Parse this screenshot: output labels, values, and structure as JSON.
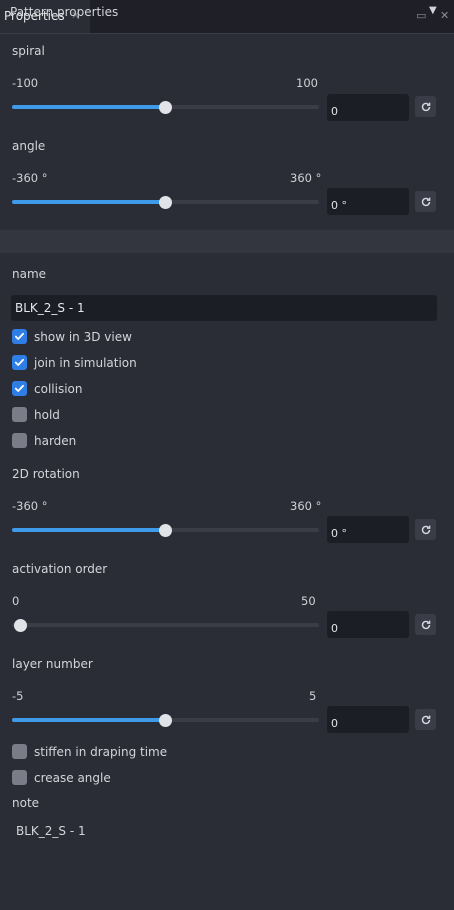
{
  "tab": {
    "label": "Properties"
  },
  "spiral": {
    "label": "spiral",
    "min": "-100",
    "max": "100",
    "value": "0",
    "level": 0.5
  },
  "angle": {
    "label": "angle",
    "min": "-360 °",
    "max": "360 °",
    "value": "0 °",
    "level": 0.5
  },
  "section": {
    "label": "Pattern properties"
  },
  "name": {
    "label": "name",
    "value": "BLK_2_S - 1"
  },
  "checks": [
    {
      "label": "show in 3D view",
      "checked": true
    },
    {
      "label": "join in simulation",
      "checked": true
    },
    {
      "label": "collision",
      "checked": true
    },
    {
      "label": "hold",
      "checked": false
    },
    {
      "label": "harden",
      "checked": false
    }
  ],
  "rotation": {
    "label": "2D rotation",
    "min": "-360 °",
    "max": "360 °",
    "value": "0 °",
    "level": 0.5
  },
  "activation": {
    "label": "activation order",
    "min": "0",
    "max": "50",
    "value": "0",
    "level": 0.0
  },
  "layer": {
    "label": "layer number",
    "min": "-5",
    "max": "5",
    "value": "0",
    "level": 0.5
  },
  "checks2": [
    {
      "label": "stiffen in draping time",
      "checked": false
    },
    {
      "label": "crease angle",
      "checked": false
    }
  ],
  "note": {
    "label": "note",
    "value": "BLK_2_S - 1"
  },
  "colors": {
    "accent": "#3f9bea",
    "checkbox_on": "#2f7ee6",
    "background": "#2b2d36"
  }
}
